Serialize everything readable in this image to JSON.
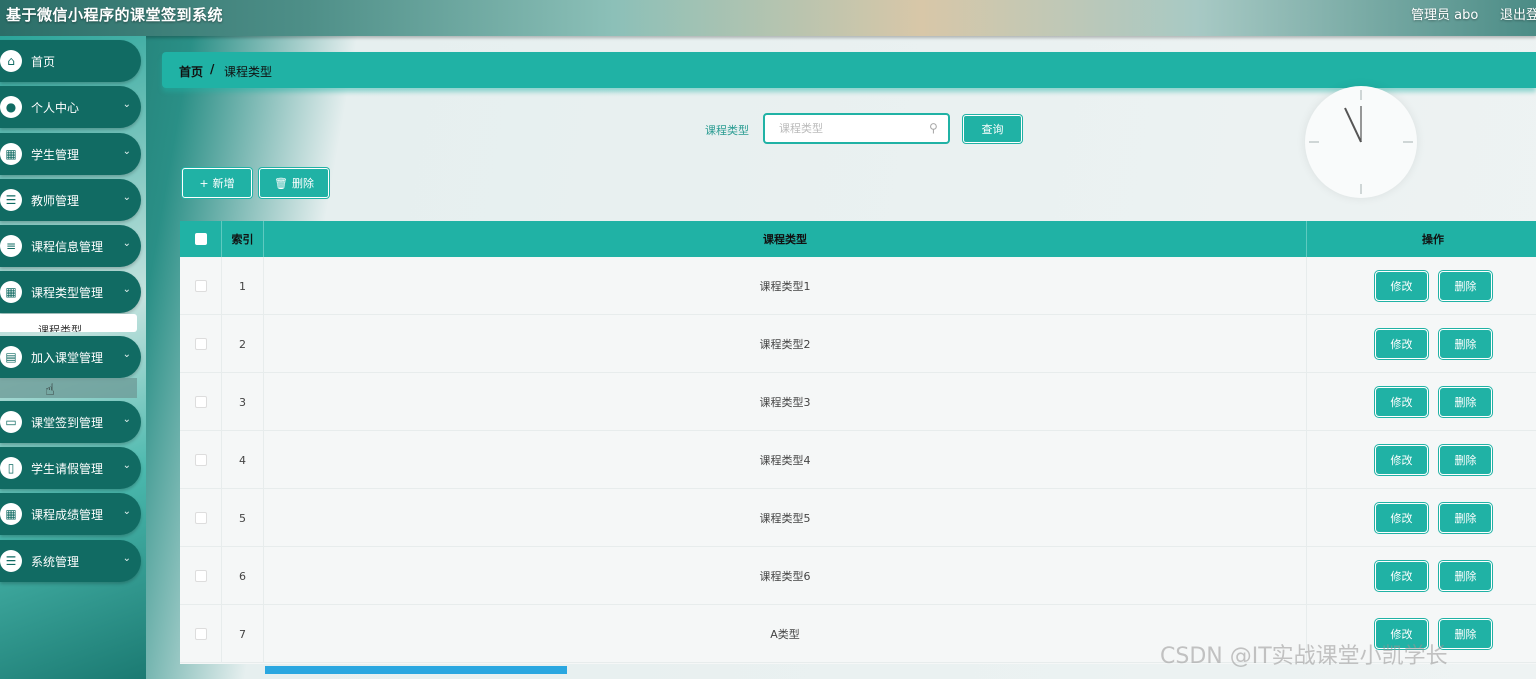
{
  "header": {
    "app_title": "基于微信小程序的课堂签到系统",
    "user_label": "管理员 abo",
    "logout": "退出登"
  },
  "sidebar": {
    "items": [
      {
        "label": "首页",
        "icon": "home-icon",
        "has_chevron": false
      },
      {
        "label": "个人中心",
        "icon": "user-icon",
        "has_chevron": true
      },
      {
        "label": "学生管理",
        "icon": "grid-icon",
        "has_chevron": true
      },
      {
        "label": "教师管理",
        "icon": "list-icon",
        "has_chevron": true
      },
      {
        "label": "课程信息管理",
        "icon": "sliders-icon",
        "has_chevron": true
      },
      {
        "label": "课程类型管理",
        "icon": "grid-icon",
        "has_chevron": true
      },
      {
        "label": "加入课堂管理",
        "icon": "chart-icon",
        "has_chevron": true
      },
      {
        "label": "课堂签到管理",
        "icon": "monitor-icon",
        "has_chevron": true
      },
      {
        "label": "学生请假管理",
        "icon": "book-icon",
        "has_chevron": true
      },
      {
        "label": "课程成绩管理",
        "icon": "grid-icon",
        "has_chevron": true
      },
      {
        "label": "系统管理",
        "icon": "list-icon",
        "has_chevron": true
      }
    ],
    "submenu_label": "课程类型"
  },
  "breadcrumb": {
    "home": "首页",
    "separator": "/",
    "current": "课程类型"
  },
  "search": {
    "label": "课程类型",
    "placeholder": "课程类型",
    "button": "查询"
  },
  "toolbar": {
    "add": "新增",
    "delete": "删除"
  },
  "table": {
    "headers": {
      "index": "索引",
      "type": "课程类型",
      "actions": "操作"
    },
    "rows": [
      {
        "index": "1",
        "type": "课程类型1"
      },
      {
        "index": "2",
        "type": "课程类型2"
      },
      {
        "index": "3",
        "type": "课程类型3"
      },
      {
        "index": "4",
        "type": "课程类型4"
      },
      {
        "index": "5",
        "type": "课程类型5"
      },
      {
        "index": "6",
        "type": "课程类型6"
      },
      {
        "index": "7",
        "type": "A类型"
      }
    ],
    "edit_label": "修改",
    "delete_label": "删除"
  },
  "watermark": "CSDN @IT实战课堂小凯学长",
  "colors": {
    "accent": "#20b2a5",
    "sidebar_item": "#116b63"
  }
}
